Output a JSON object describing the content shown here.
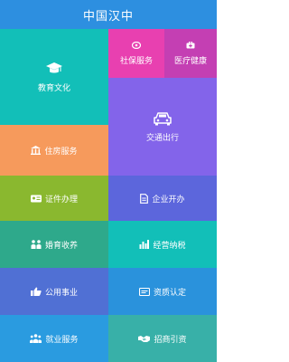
{
  "header": {
    "title": "中国汉中"
  },
  "tiles": {
    "education": {
      "label": "教育文化",
      "color": "#12bfb8"
    },
    "social_security": {
      "label": "社保服务",
      "color": "#e840b0"
    },
    "medical": {
      "label": "医疗健康",
      "color": "#c43fb3"
    },
    "transport": {
      "label": "交通出行",
      "color": "#8364ea"
    },
    "housing": {
      "label": "住房服务",
      "color": "#f69a5c"
    },
    "certificates": {
      "label": "证件办理",
      "color": "#8ab82f"
    },
    "business_open": {
      "label": "企业开办",
      "color": "#5c66dc"
    },
    "birth": {
      "label": "婚育收养",
      "color": "#2ea98b"
    },
    "tax": {
      "label": "经营纳税",
      "color": "#12bfb8"
    },
    "public_affairs": {
      "label": "公用事业",
      "color": "#5070d4"
    },
    "qualification": {
      "label": "资质认定",
      "color": "#2a92dc"
    },
    "employment": {
      "label": "就业服务",
      "color": "#2a9be0"
    },
    "investment": {
      "label": "招商引资",
      "color": "#38b0a8"
    }
  }
}
